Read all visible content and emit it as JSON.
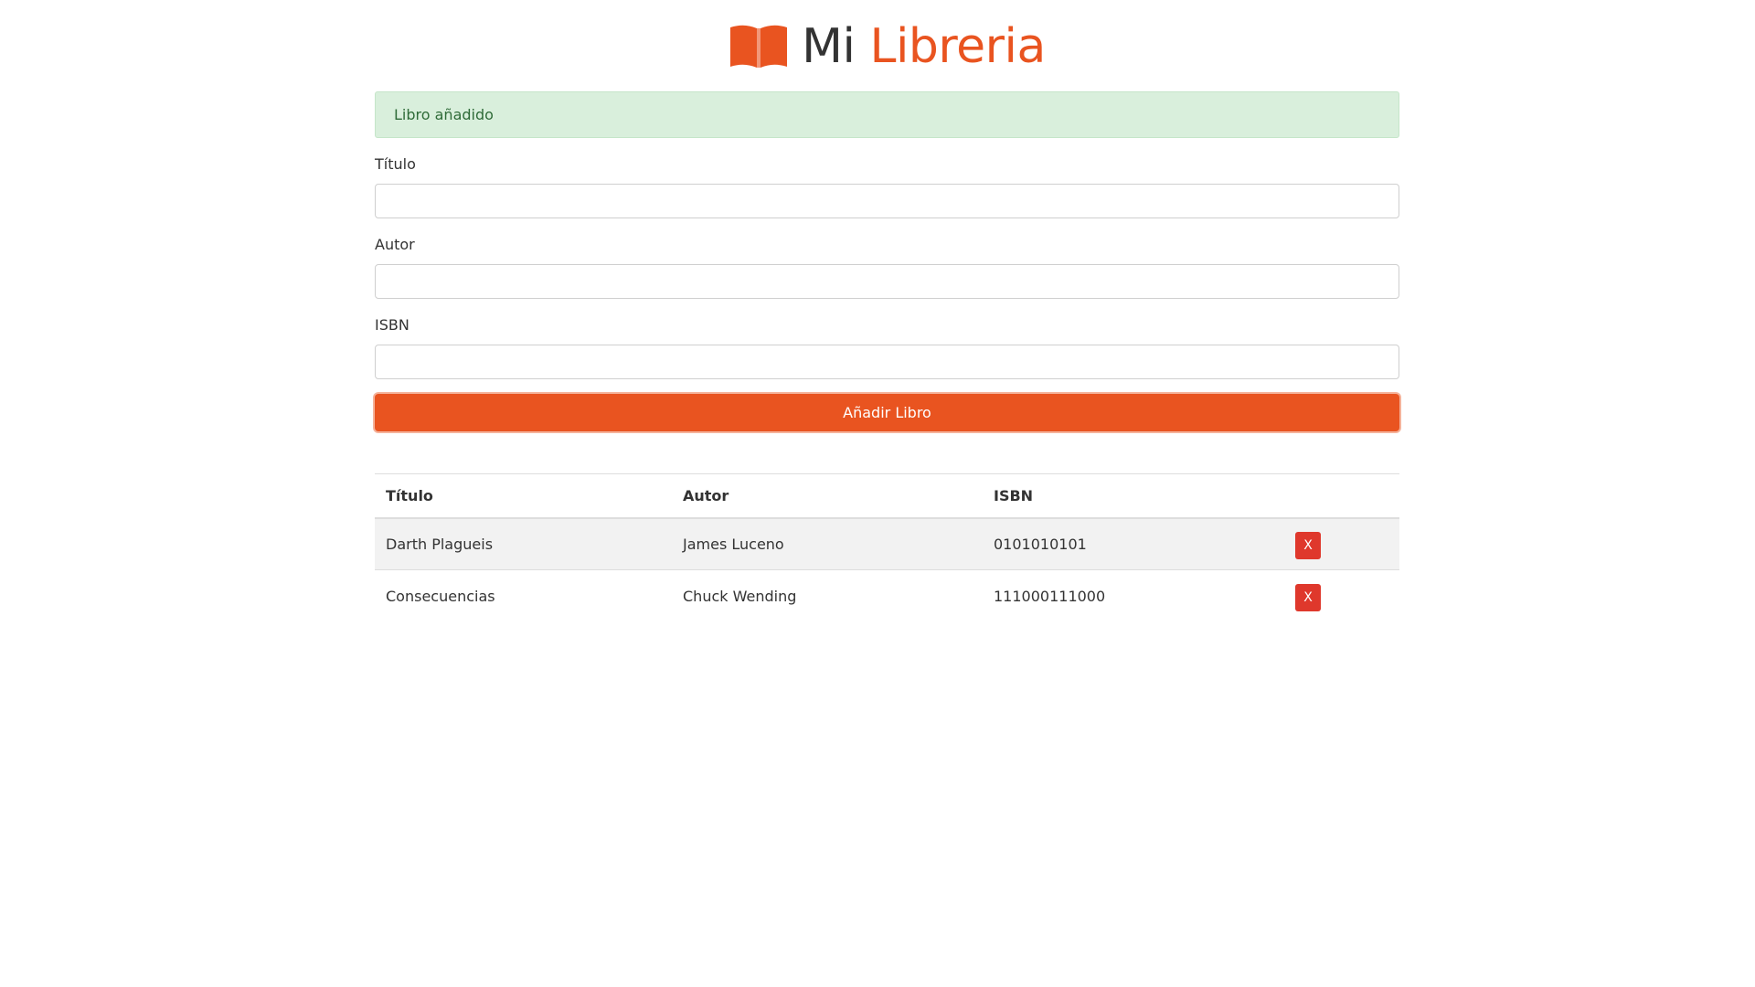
{
  "header": {
    "logo_icon": "book-open-icon",
    "title_part1": "Mi",
    "title_part2": "Libreria",
    "accent_color": "#e95420"
  },
  "alert": {
    "message": "Libro añadido",
    "status_color": "#d9efdc"
  },
  "form": {
    "title_label": "Título",
    "title_value": "",
    "author_label": "Autor",
    "author_value": "",
    "isbn_label": "ISBN",
    "isbn_value": "",
    "submit_label": "Añadir Libro"
  },
  "table": {
    "columns": [
      "Título",
      "Autor",
      "ISBN",
      ""
    ],
    "rows": [
      {
        "title": "Darth Plagueis",
        "author": "James Luceno",
        "isbn": "0101010101",
        "delete_label": "X"
      },
      {
        "title": "Consecuencias",
        "author": "Chuck Wending",
        "isbn": "111000111000",
        "delete_label": "X"
      }
    ],
    "delete_color": "#df382c"
  }
}
